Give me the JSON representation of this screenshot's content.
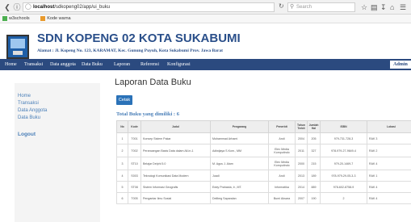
{
  "browser": {
    "url_host": "localhost",
    "url_path": "/sdkopeng02/app/ui_buku",
    "search_placeholder": "Search",
    "bookmarks": [
      "w3schools",
      "Kode warna"
    ]
  },
  "header": {
    "school_name": "SDN KOPENG 02 KOTA SUKABUMI",
    "address": "Alamat : Jl. Kopeng No. 123, KARAMAT, Kec. Gunung Puyuh, Kota Sukabumi Prov. Jawa Barat"
  },
  "navbar": {
    "items": [
      "Home",
      "Transaksi",
      "Data anggota",
      "Data Buku",
      "Laporan",
      "Referensi",
      "Konfigurasi"
    ],
    "user": "Admin"
  },
  "sidebar": {
    "links": [
      "Home",
      "Transaksi",
      "Data Anggota",
      "Data Buku"
    ],
    "logout": "Logout"
  },
  "content": {
    "title": "Laporan Data Buku",
    "print_button": "Cetak",
    "total_text": "Total Buku yang dimiliki : 6"
  },
  "table": {
    "headers": [
      "No",
      "Kode",
      "Judul",
      "Pengarang",
      "Penerbit",
      "Tahun Terbit",
      "Jumlah Hal",
      "ISBN",
      "Lokasi"
    ],
    "rows": [
      [
        "1",
        "T001",
        "Konsep Sistem Pakar",
        "Muhammad Arhami",
        "Andi",
        "2004",
        "205",
        "979-731-728-3",
        "RAK 3"
      ],
      [
        "2",
        "T002",
        "Perancangan Basis Data dalam All-in-1",
        "Adiwijaya S.Kom., MM",
        "Elex Media Komputindo",
        "2011",
        "327",
        "978-979-27-9649-4",
        "RAK 2"
      ],
      [
        "3",
        "ST10",
        "Belajar Delphi 5.0",
        "M. Agus J. Alam",
        "Elex Media Komputindo",
        "2000",
        "215",
        "979-20-1469-7",
        "RAK 4"
      ],
      [
        "4",
        "S003",
        "Teknologi Komunikasi Data Modern",
        "Juadi",
        "Andi",
        "2013",
        "189",
        "978-979-29-05-3-3",
        "RAK 1"
      ],
      [
        "5",
        "ST08",
        "Sistem Informasi Geografis",
        "Eddy Prahasta, Ir., MT.",
        "Informatika",
        "2014",
        "889",
        "978-602-8758-9",
        "RAK 4"
      ],
      [
        "6",
        "T005",
        "Pengantar Ilmu Sosial",
        "Delibeg Saparalan",
        "Bumi Aksara",
        "2007",
        "190",
        "2",
        "RAK 4"
      ]
    ]
  },
  "colors": {
    "brand_blue": "#2b4a7f",
    "link_blue": "#4a7fb8",
    "button_blue": "#2b72b8"
  }
}
